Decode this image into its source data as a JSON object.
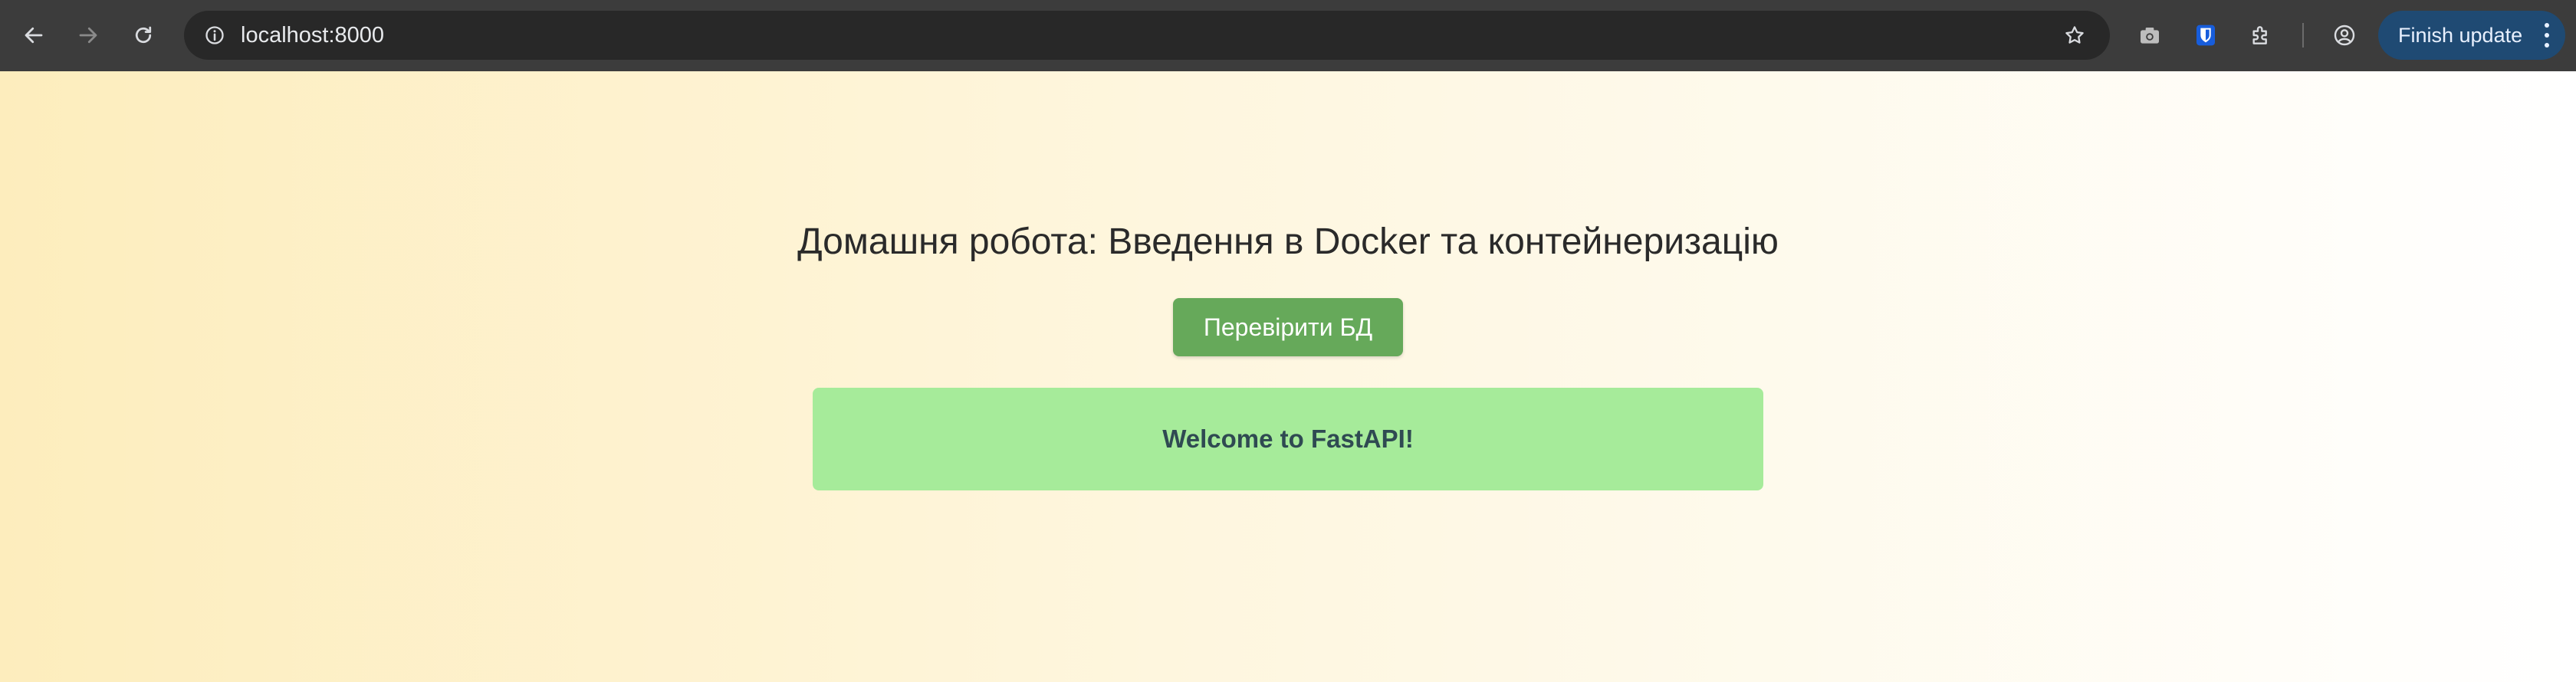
{
  "browser": {
    "url": "localhost:8000",
    "update_button_label": "Finish update",
    "icons": {
      "back": "back-arrow-icon",
      "forward": "forward-arrow-icon",
      "reload": "reload-icon",
      "site_info": "info-icon",
      "bookmark": "star-icon",
      "screenshot": "camera-icon",
      "bitwarden": "shield-icon",
      "extensions": "puzzle-icon",
      "profile": "profile-icon",
      "menu": "kebab-menu-icon"
    },
    "colors": {
      "toolbar": "#3c3c3c",
      "omnibox": "#282828",
      "update_button": "#1f4a73"
    }
  },
  "page": {
    "heading": "Домашня робота: Введення в Docker та контейнеризацію",
    "check_db_button_label": "Перевірити БД",
    "message": "Welcome to FastAPI!",
    "colors": {
      "button": "#66a95a",
      "message_box": "#a6eb9a",
      "gradient_start": "#fdedbd",
      "gradient_end": "#ffffff"
    }
  }
}
